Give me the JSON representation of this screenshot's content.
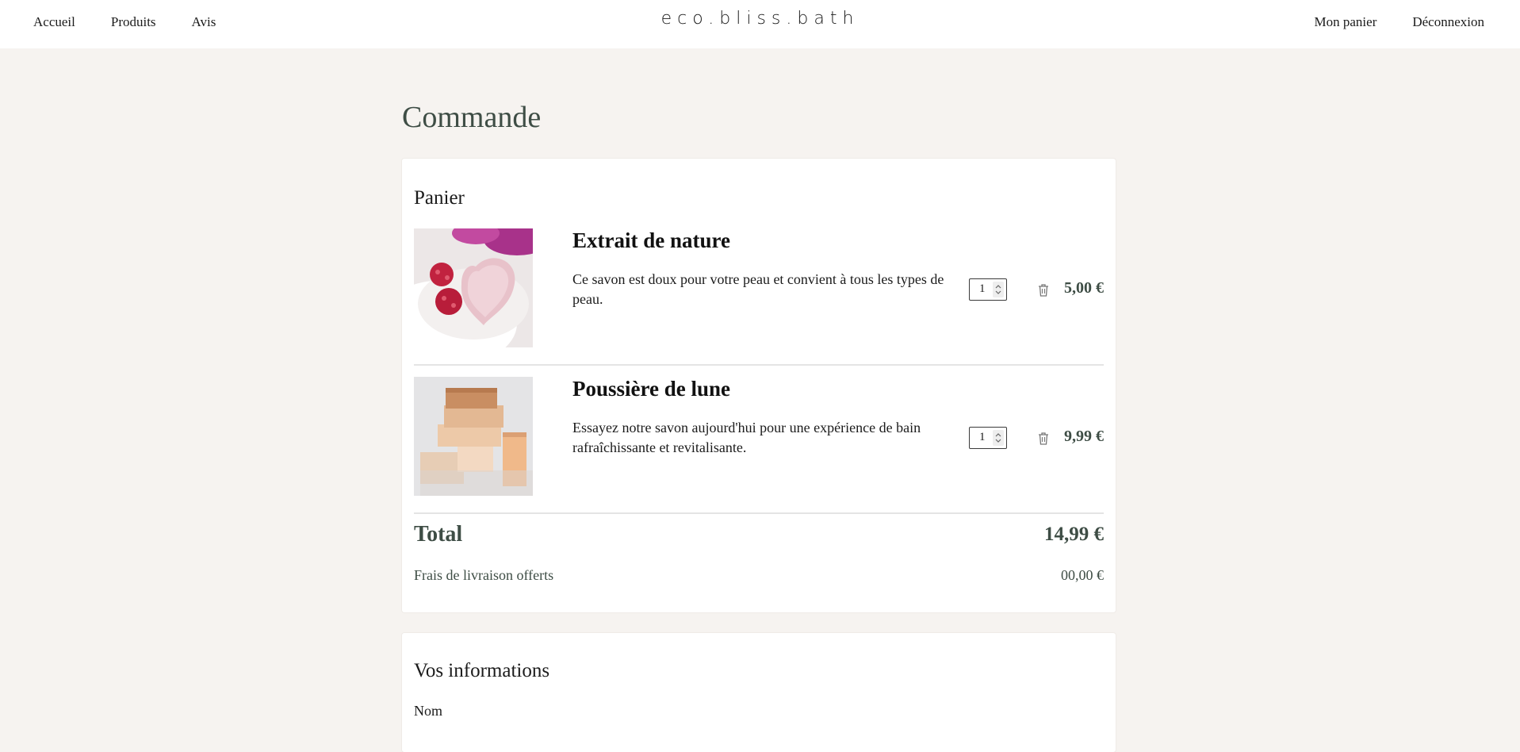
{
  "header": {
    "nav_left": [
      "Accueil",
      "Produits",
      "Avis"
    ],
    "brand": "eco.bliss.bath",
    "nav_right": [
      "Mon panier",
      "Déconnexion"
    ]
  },
  "page": {
    "title": "Commande"
  },
  "cart": {
    "title": "Panier",
    "items": [
      {
        "name": "Extrait de nature",
        "description": "Ce savon est doux pour votre peau et convient à tous les types de peau.",
        "quantity": "1",
        "price": "5,00 €",
        "image": "pink-heart-soap-with-raspberries"
      },
      {
        "name": "Poussière de lune",
        "description": "Essayez notre savon aujourd'hui pour une expérience de bain rafraîchissante et revitalisante.",
        "quantity": "1",
        "price": "9,99 €",
        "image": "stacked-soap-bars"
      }
    ],
    "total_label": "Total",
    "total_value": "14,99 €",
    "shipping_label": "Frais de livraison offerts",
    "shipping_value": "00,00 €"
  },
  "info": {
    "title": "Vos informations",
    "name_label": "Nom"
  },
  "colors": {
    "accent": "#3e4d45",
    "page_bg": "#f6f3f0",
    "card_bg": "#ffffff"
  }
}
